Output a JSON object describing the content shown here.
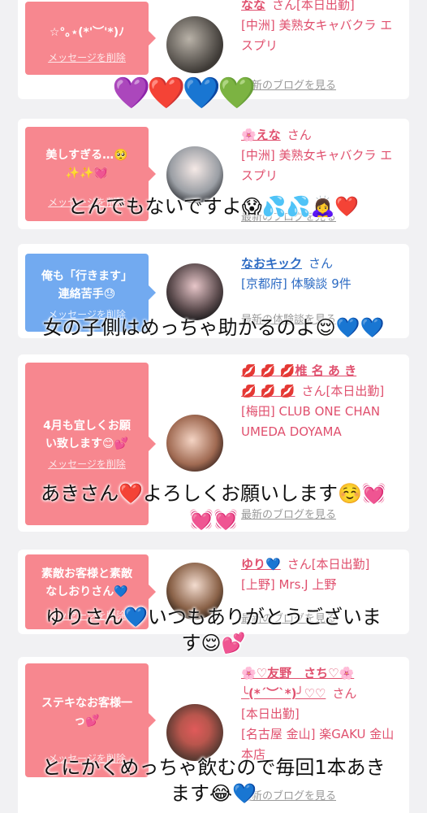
{
  "cards": [
    {
      "message": "☆°｡⋆(*'︶'*)ﾉ",
      "delete_label": "メッセージを削除",
      "name": "なな",
      "honorific": "さん[本日出勤]",
      "sub": "[中洲] 美熟女キャバクラ エスプリ",
      "blog": "最新のブログを見る"
    },
    {
      "message": "美しすぎる…🥺\n✨✨💓",
      "delete_label": "メッセージを削除",
      "name": "🌸えな",
      "honorific": "さん",
      "sub": "[中洲] 美熟女キャバクラ エスプリ",
      "blog": "最新のブログを見る"
    },
    {
      "message": "俺も「行きます」\n連絡苦手😓",
      "delete_label": "メッセージを削除",
      "name": "なおキック",
      "honorific": "さん",
      "sub": "[京都府] 体験談 9件",
      "blog": "最新の体験談を見る"
    },
    {
      "message": "4月も宜しくお願\nい致します😊💕",
      "delete_label": "メッセージを削除",
      "name": "💋 💋 💋椎 名 あ き\n💋 💋 💋",
      "honorific": "さん[本日出勤]",
      "sub": "[梅田] CLUB ONE CHAN UMEDA DOYAMA",
      "blog": "最新のブログを見る"
    },
    {
      "message": "素敵お客様と素敵\nなしおりさん💙",
      "delete_label": "メッセージを削除",
      "name": "ゆり💙",
      "honorific": "さん[本日出勤]",
      "sub": "[上野] Mrs.J 上野",
      "blog": "最新のブログを見る"
    },
    {
      "message": "ステキなお客様一\nっ💕",
      "delete_label": "メッセージを削除",
      "name": "🌸♡友野　さち♡🌸\n╰(*´︶`*)╯♡♡",
      "honorific": "さん",
      "sub": "[本日出勤]\n[名古屋 金山] 楽GAKU 金山本店",
      "blog": "最新のブログを見る"
    }
  ],
  "overlays": {
    "hearts": "💜❤️💙💚",
    "t1": "とんでもないですよ😱💦💦🙇‍♀️❤️",
    "t2": "女の子側はめっちゃ助かるのよ😌💙💙",
    "t3": "あきさん❤️よろしくお願いします☺️💓\n💓💓",
    "t4": "ゆりさん💙いつもありがとうございま\nす😌💕",
    "t5": "とにかくめっちゃ飲むので毎回1本あき\nます😂💙"
  },
  "colors": {
    "bubble_pink": "#f7878f",
    "bubble_blue": "#72aaf0",
    "name_pink": "#e0506e",
    "name_blue": "#2e6cc4"
  }
}
